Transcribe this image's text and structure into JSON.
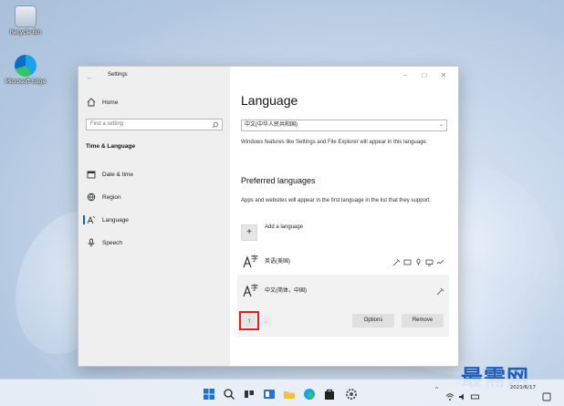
{
  "desktop": {
    "icons": [
      {
        "label": "Recycle Bin"
      },
      {
        "label": "Microsoft Edge"
      }
    ]
  },
  "window": {
    "title": "Settings",
    "controls": {
      "minimize": "–",
      "maximize": "□",
      "close": "✕"
    }
  },
  "sidebar": {
    "home": "Home",
    "search_placeholder": "Find a setting",
    "section_heading": "Time & Language",
    "items": [
      {
        "label": "Date & time",
        "icon": "calendar-clock-icon"
      },
      {
        "label": "Region",
        "icon": "globe-icon"
      },
      {
        "label": "Language",
        "icon": "language-icon",
        "active": true
      },
      {
        "label": "Speech",
        "icon": "microphone-icon"
      }
    ]
  },
  "main": {
    "title": "Language",
    "display_language": "中文(中华人民共和国)",
    "display_note": "Windows features like Settings and File Explorer will appear in this language.",
    "preferred_heading": "Preferred languages",
    "preferred_note": "Apps and websites will appear in the first language in the list that they support.",
    "add_language": "Add a language",
    "languages": [
      {
        "name": "英语(美国)",
        "features": [
          "pen-icon",
          "keyboard-icon",
          "microphone-icon",
          "display-icon",
          "handwriting-icon"
        ]
      },
      {
        "name": "中文(简体，中国)",
        "features": [
          "pen-icon"
        ]
      }
    ],
    "options_button": "Options",
    "remove_button": "Remove",
    "move_up": "↑",
    "move_down": "↓"
  },
  "taskbar": {
    "tray_chevron": "^",
    "date": "2021/6/17"
  },
  "watermark": "最需网",
  "colors": {
    "accent": "#0a66c2",
    "highlight": "#e02020",
    "watermark": "#1f5bb8"
  }
}
